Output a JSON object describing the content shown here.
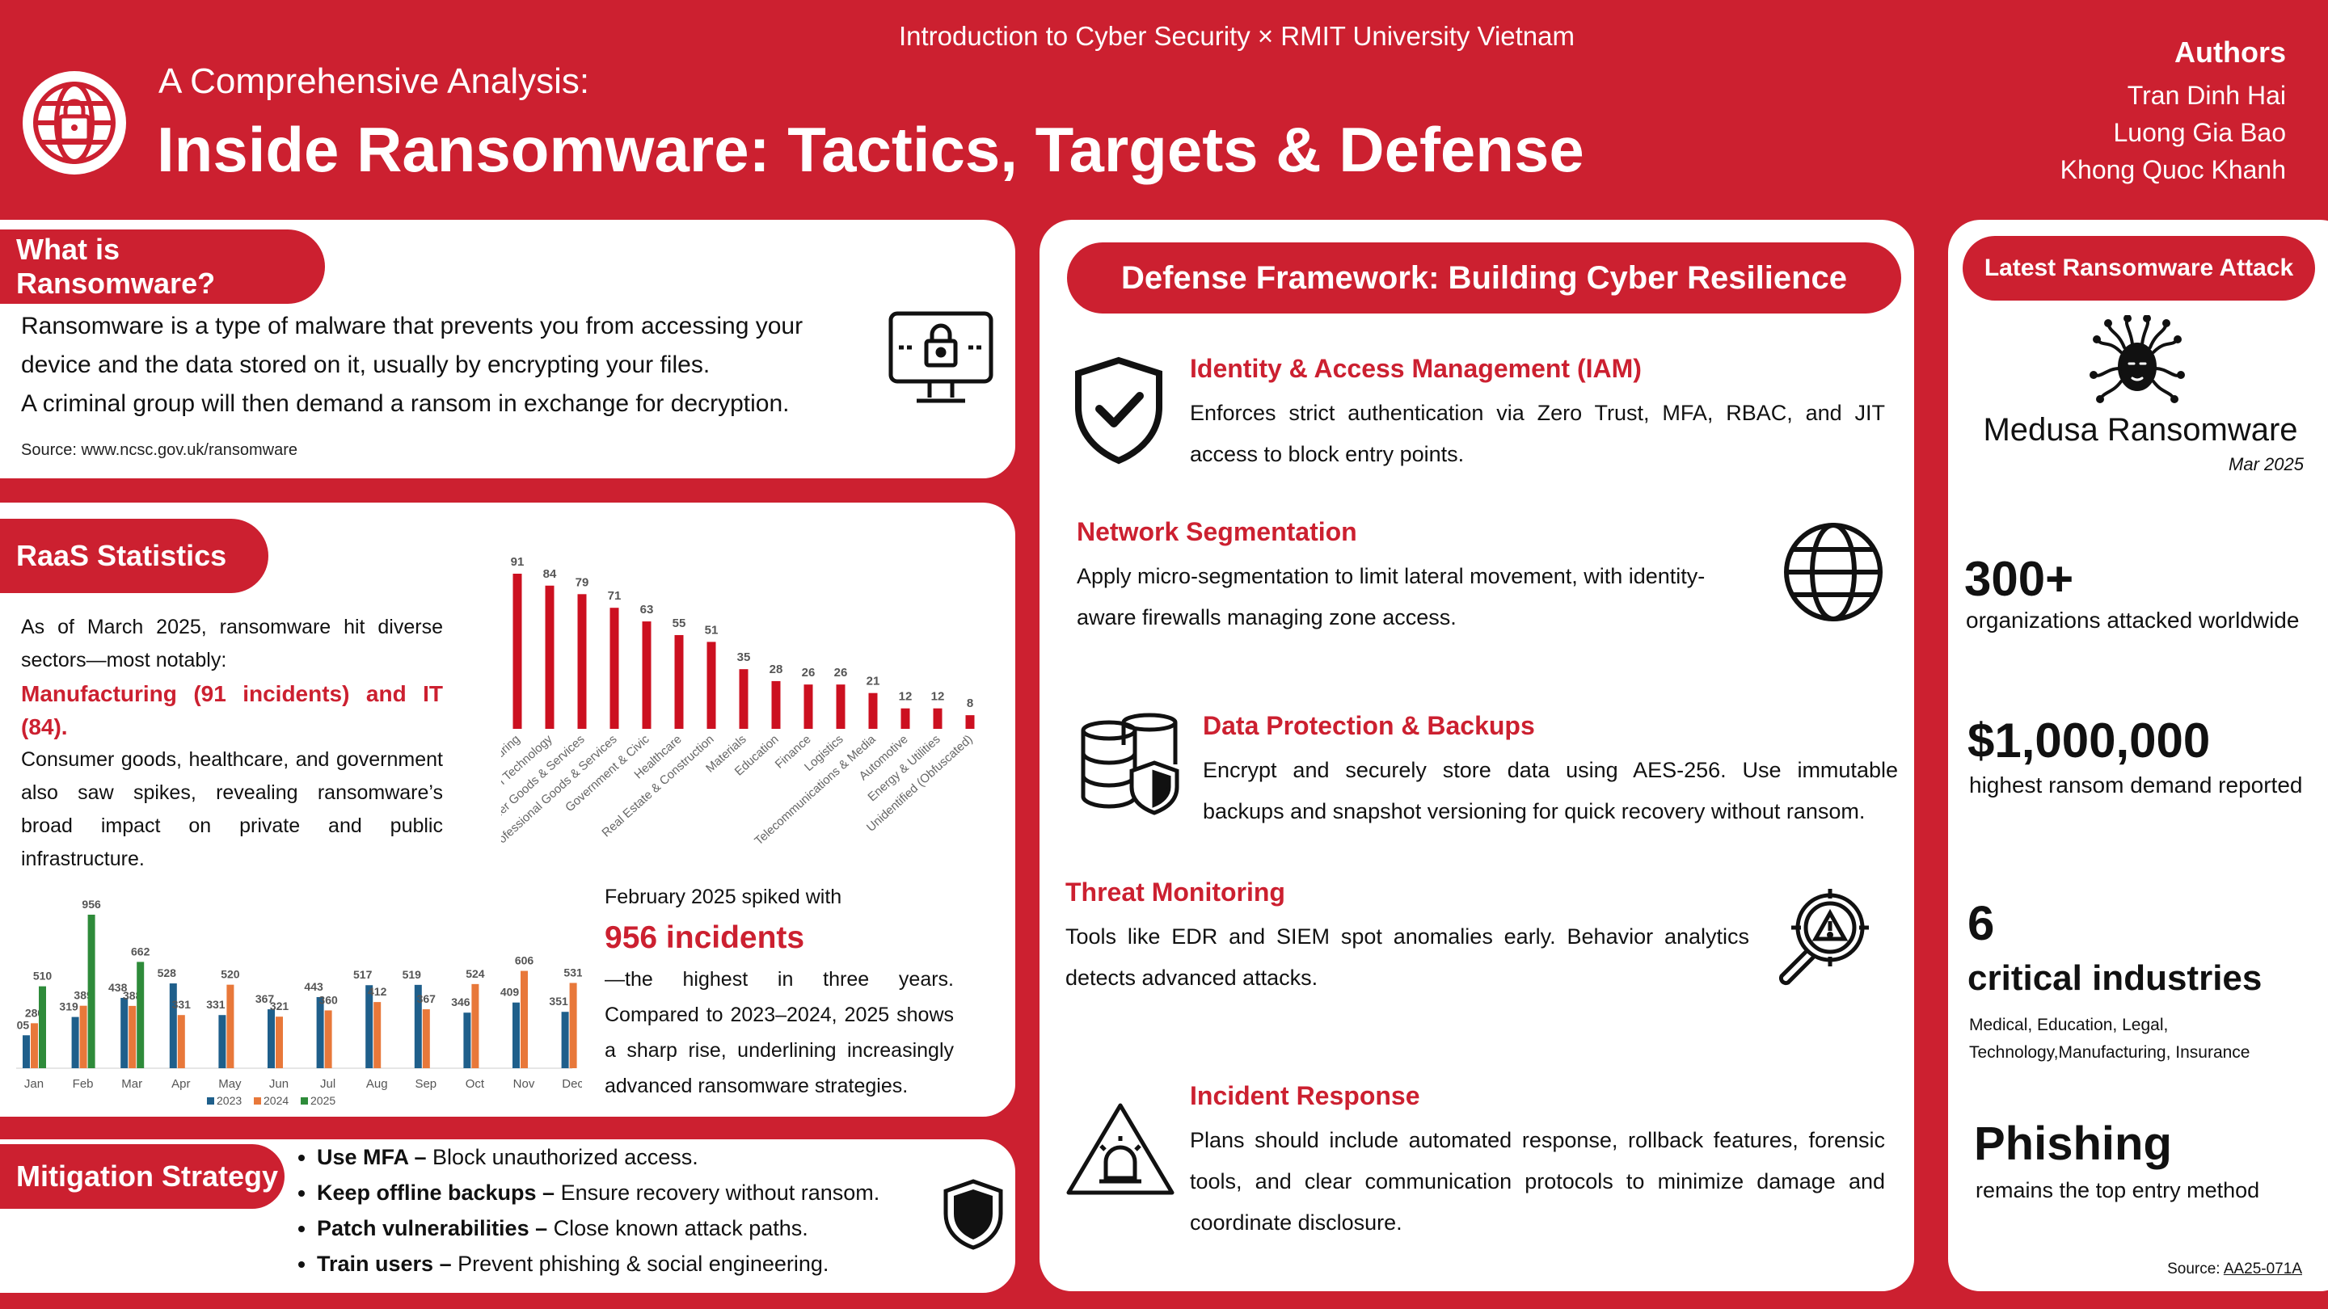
{
  "header": {
    "course": "Introduction to Cyber Security × RMIT University Vietnam",
    "subtitle": "A Comprehensive Analysis:",
    "title": "Inside Ransomware: Tactics, Targets & Defense",
    "authors_label": "Authors",
    "authors": [
      "Tran Dinh Hai",
      "Luong Gia Bao",
      "Khong Quoc Khanh"
    ]
  },
  "what_is": {
    "heading": "What is Ransomware?",
    "lines": [
      "Ransomware is a type of malware that prevents you from accessing your",
      "device and the data stored on it, usually by encrypting your files.",
      "A criminal group will then demand a ransom in exchange for decryption."
    ],
    "source": "Source: www.ncsc.gov.uk/ransomware"
  },
  "raas": {
    "heading": "RaaS Statistics",
    "intro": "As of March 2025, ransomware hit diverse sectors—most notably:",
    "highlight": "Manufacturing (91 incidents) and IT (84).",
    "rest": "Consumer goods, healthcare, and government also saw spikes, revealing ransomware’s broad impact on private and public infrastructure.",
    "feb_line1": "February 2025 spiked with",
    "feb_highlight": "956 incidents",
    "feb_rest": "—the highest in three years. Compared to 2023–2024, 2025 shows a sharp rise, underlining increasingly advanced ransomware strategies."
  },
  "chart_data": [
    {
      "type": "bar",
      "categories": [
        "Manufacturing",
        "Information Technology",
        "Consumer Goods & Services",
        "Professional Goods & Services",
        "Government & Civic",
        "Healthcare",
        "Real Estate & Construction",
        "Materials",
        "Education",
        "Finance",
        "Logistics",
        "Telecommunications & Media",
        "Automotive",
        "Energy & Utilities",
        "Unidentified (Obfuscated)"
      ],
      "values": [
        91,
        84,
        79,
        71,
        63,
        55,
        51,
        35,
        28,
        26,
        26,
        21,
        12,
        12,
        8
      ],
      "color": "#cc1020"
    },
    {
      "type": "bar",
      "categories": [
        "Jan",
        "Feb",
        "Mar",
        "Apr",
        "May",
        "Jun",
        "Jul",
        "Aug",
        "Sep",
        "Oct",
        "Nov",
        "Dec"
      ],
      "series": [
        {
          "name": "2023",
          "color": "#1f5f8b",
          "values": [
            205,
            319,
            438,
            528,
            331,
            367,
            443,
            517,
            519,
            346,
            409,
            351
          ]
        },
        {
          "name": "2024",
          "color": "#e8783a",
          "values": [
            280,
            389,
            388,
            331,
            520,
            321,
            360,
            412,
            367,
            524,
            606,
            531
          ]
        },
        {
          "name": "2025",
          "color": "#2e8b3a",
          "values": [
            510,
            956,
            662,
            null,
            null,
            null,
            null,
            null,
            null,
            null,
            null,
            null
          ]
        }
      ]
    }
  ],
  "mitigation": {
    "heading": "Mitigation Strategy",
    "items": [
      {
        "bold": "Use MFA –",
        "text": " Block unauthorized access."
      },
      {
        "bold": "Keep offline backups –",
        "text": " Ensure recovery without ransom."
      },
      {
        "bold": "Patch vulnerabilities –",
        "text": " Close known attack paths."
      },
      {
        "bold": "Train users –",
        "text": " Prevent phishing & social engineering."
      }
    ]
  },
  "defense": {
    "heading": "Defense Framework: Building Cyber Resilience",
    "iam_title": "Identity & Access Management (IAM)",
    "iam_text": "Enforces strict authentication via Zero Trust, MFA, RBAC, and JIT access to block entry points.",
    "net_title": "Network Segmentation",
    "net_text": "Apply micro-segmentation to limit lateral movement, with identity-aware firewalls managing zone access.",
    "data_title": "Data Protection & Backups",
    "data_text": "Encrypt and securely store data using AES-256. Use immutable backups and snapshot versioning for quick recovery without ransom.",
    "threat_title": "Threat Monitoring",
    "threat_text": "Tools like EDR and SIEM spot anomalies early. Behavior analytics detects advanced attacks.",
    "ir_title": "Incident Response",
    "ir_text": "Plans should include automated response, rollback features, forensic tools, and clear communication protocols to minimize damage and coordinate disclosure."
  },
  "latest": {
    "heading": "Latest Ransomware Attack",
    "name": "Medusa Ransomware",
    "date": "Mar 2025",
    "stat1_value": "300+",
    "stat1_label": "organizations attacked worldwide",
    "stat2_value": "$1,000,000",
    "stat2_label": "highest ransom demand reported",
    "stat3_value": "6",
    "stat3_label": "critical industries",
    "stat3_list": "Medical, Education, Legal, Technology,Manufacturing, Insurance",
    "stat4_value": "Phishing",
    "stat4_label": "remains the top entry method",
    "source_label": "Source:",
    "source_link": "AA25-071A"
  }
}
